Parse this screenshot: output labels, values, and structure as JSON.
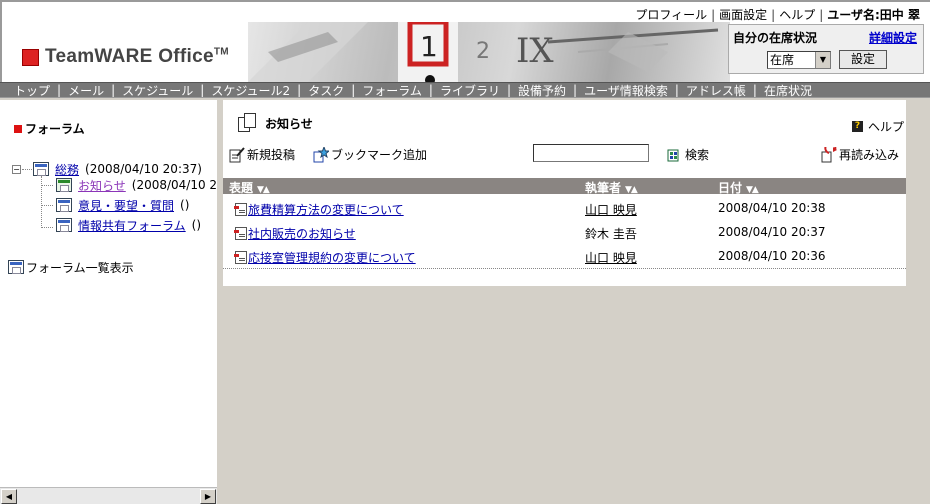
{
  "topmenu": {
    "profile": "プロフィール",
    "screen_settings": "画面設定",
    "help": "ヘルプ",
    "user_label": "ユーザ名:田中 翠"
  },
  "logo": {
    "text": "TeamWARE Office",
    "tm": "TM"
  },
  "status_panel": {
    "title": "自分の在席状況",
    "detail_link": "詳細設定",
    "selected": "在席",
    "set_button": "設定"
  },
  "nav": [
    "トップ",
    "メール",
    "スケジュール",
    "スケジュール2",
    "タスク",
    "フォーラム",
    "ライブラリ",
    "設備予約",
    "ユーザ情報検索",
    "アドレス帳",
    "在席状況"
  ],
  "left": {
    "title": "フォーラム",
    "tree": {
      "root_label": "総務",
      "root_time": "(2008/04/10 20:37)",
      "children": [
        {
          "label": "お知らせ",
          "extra": "(2008/04/10 20"
        },
        {
          "label": "意見・要望・質問",
          "extra": "()"
        },
        {
          "label": "情報共有フォーラム",
          "extra": "()"
        }
      ]
    },
    "forum_list": "フォーラム一覧表示"
  },
  "main": {
    "page_title": "お知らせ",
    "help": "ヘルプ",
    "toolbar": {
      "new_post": "新規投稿",
      "bookmark_add": "ブックマーク追加",
      "search_value": "",
      "search_button": "検索",
      "reload": "再読み込み"
    },
    "columns": {
      "subject": "表題",
      "author": "執筆者",
      "date": "日付"
    },
    "rows": [
      {
        "subject": "旅費精算方法の変更について",
        "author": "山口 映見",
        "date": "2008/04/10 20:38"
      },
      {
        "subject": "社内販売のお知らせ",
        "author": "鈴木 圭吾",
        "date": "2008/04/10 20:37"
      },
      {
        "subject": "応接室管理規約の変更について",
        "author": "山口 映見",
        "date": "2008/04/10 20:36"
      }
    ]
  },
  "icons": {
    "forum_tree": "forum-folder-icon",
    "new_post": "pencil-doc-icon",
    "bookmark": "bookmark-star-icon",
    "search": "search-icon",
    "reload": "reload-icon",
    "help": "help-icon"
  },
  "colors": {
    "nav_bg": "#777777",
    "table_header_bg": "#8a8582",
    "link": "#0000aa",
    "visited_link": "#8b35b8",
    "logo_red": "#dd2222"
  }
}
